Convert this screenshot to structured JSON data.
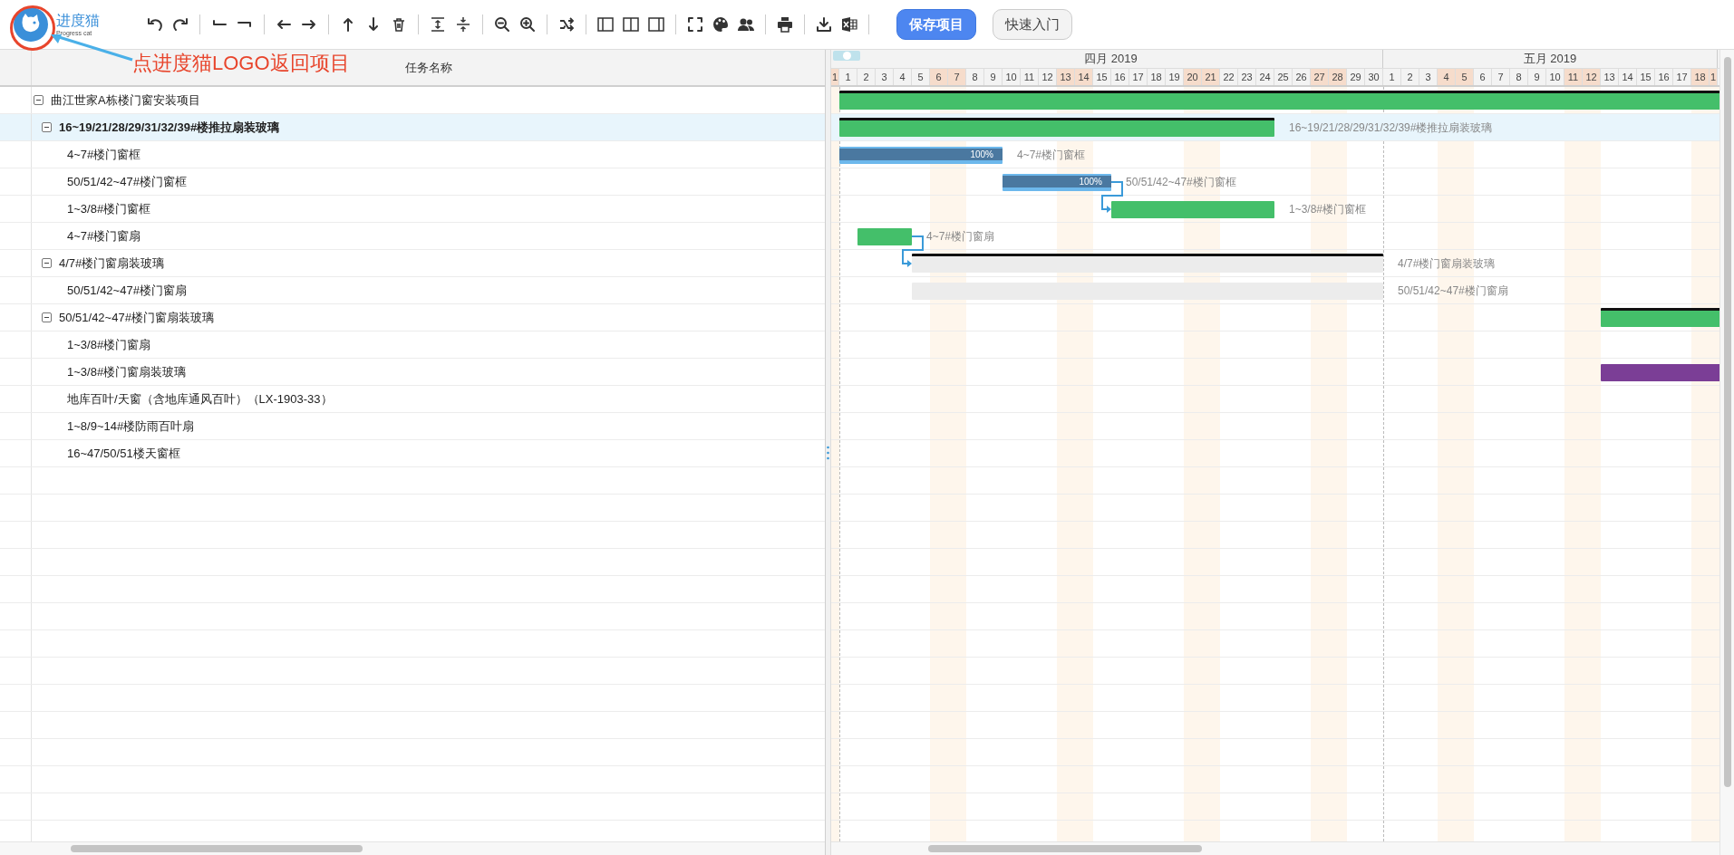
{
  "toolbar": {
    "logo": {
      "name": "进度猫",
      "subtitle": "Progress cat"
    },
    "buttons": [
      {
        "label": "保存项目",
        "kind": "primary"
      },
      {
        "label": "快速入门",
        "kind": "secondary"
      }
    ]
  },
  "annotation": {
    "text": "点进度猫LOGO返回项目"
  },
  "grid": {
    "columns": [
      {
        "label": "任务名称"
      }
    ]
  },
  "timeline": {
    "zoom_slider": {
      "level": 0.5
    },
    "leading_day": {
      "label": "1",
      "weekend": true
    },
    "months": [
      {
        "label": "四月 2019",
        "days": [
          {
            "label": "1",
            "weekend": false
          },
          {
            "label": "2",
            "weekend": false
          },
          {
            "label": "3",
            "weekend": false
          },
          {
            "label": "4",
            "weekend": false
          },
          {
            "label": "5",
            "weekend": false
          },
          {
            "label": "6",
            "weekend": true
          },
          {
            "label": "7",
            "weekend": true
          },
          {
            "label": "8",
            "weekend": false
          },
          {
            "label": "9",
            "weekend": false
          },
          {
            "label": "10",
            "weekend": false
          },
          {
            "label": "11",
            "weekend": false
          },
          {
            "label": "12",
            "weekend": false
          },
          {
            "label": "13",
            "weekend": true
          },
          {
            "label": "14",
            "weekend": true
          },
          {
            "label": "15",
            "weekend": false
          },
          {
            "label": "16",
            "weekend": false
          },
          {
            "label": "17",
            "weekend": false
          },
          {
            "label": "18",
            "weekend": false
          },
          {
            "label": "19",
            "weekend": false
          },
          {
            "label": "20",
            "weekend": true
          },
          {
            "label": "21",
            "weekend": true
          },
          {
            "label": "22",
            "weekend": false
          },
          {
            "label": "23",
            "weekend": false
          },
          {
            "label": "24",
            "weekend": false
          },
          {
            "label": "25",
            "weekend": false
          },
          {
            "label": "26",
            "weekend": false
          },
          {
            "label": "27",
            "weekend": true
          },
          {
            "label": "28",
            "weekend": true
          },
          {
            "label": "29",
            "weekend": false
          },
          {
            "label": "30",
            "weekend": false
          }
        ]
      },
      {
        "label": "五月 2019",
        "days": [
          {
            "label": "1",
            "weekend": false
          },
          {
            "label": "2",
            "weekend": false
          },
          {
            "label": "3",
            "weekend": false
          },
          {
            "label": "4",
            "weekend": true
          },
          {
            "label": "5",
            "weekend": true
          },
          {
            "label": "6",
            "weekend": false
          },
          {
            "label": "7",
            "weekend": false
          },
          {
            "label": "8",
            "weekend": false
          },
          {
            "label": "9",
            "weekend": false
          },
          {
            "label": "10",
            "weekend": false
          },
          {
            "label": "11",
            "weekend": true
          },
          {
            "label": "12",
            "weekend": true
          },
          {
            "label": "13",
            "weekend": false
          },
          {
            "label": "14",
            "weekend": false
          },
          {
            "label": "15",
            "weekend": false
          },
          {
            "label": "16",
            "weekend": false
          },
          {
            "label": "17",
            "weekend": false
          },
          {
            "label": "18",
            "weekend": true
          }
        ]
      }
    ],
    "trailing_day": {
      "label": "1",
      "weekend": true
    }
  },
  "tasks": [
    {
      "name": "曲江世家A栋楼门窗安装项目",
      "expanded": true,
      "selected": false,
      "linked_to_next": false,
      "bar": {
        "kind": "summary",
        "color": "#44bf6a"
      },
      "children": [
        {
          "name": "16~19/21/28/29/31/32/39#楼推拉扇装玻璃",
          "expanded": true,
          "selected": true,
          "linked_to_next": false,
          "bar": {
            "kind": "summary",
            "color": "#44bf6a",
            "label": "16~19/21/28/29/31/32/39#楼推拉扇装玻璃"
          },
          "children": [
            {
              "name": "4~7#楼门窗框",
              "selected": false,
              "linked_to_next": false,
              "bar": {
                "kind": "progress",
                "color": "#6db8ec",
                "level": 1,
                "progress_text": "100%",
                "label": "4~7#楼门窗框"
              }
            },
            {
              "name": "50/51/42~47#楼门窗框",
              "selected": false,
              "linked_to_next": true,
              "bar": {
                "kind": "progress",
                "color": "#6db8ec",
                "level": 1,
                "progress_text": "100%",
                "label": "50/51/42~47#楼门窗框"
              }
            },
            {
              "name": "1~3/8#楼门窗框",
              "selected": false,
              "linked_to_next": false,
              "bar": {
                "kind": "task",
                "color": "#44bf6a",
                "label": "1~3/8#楼门窗框"
              }
            },
            {
              "name": "4~7#楼门窗扇",
              "selected": false,
              "linked_to_next": true,
              "bar": {
                "kind": "task",
                "color": "#44bf6a",
                "label": "4~7#楼门窗扇"
              }
            }
          ]
        },
        {
          "name": "4/7#楼门窗扇装玻璃",
          "expanded": true,
          "selected": false,
          "linked_to_next": false,
          "bar": {
            "kind": "summary",
            "color": "#ececec",
            "label": "4/7#楼门窗扇装玻璃"
          },
          "children": [
            {
              "name": "50/51/42~47#楼门窗扇",
              "selected": false,
              "linked_to_next": false,
              "bar": {
                "kind": "task",
                "color": "#ececec",
                "label": "50/51/42~47#楼门窗扇"
              }
            }
          ]
        },
        {
          "name": "50/51/42~47#楼门窗扇装玻璃",
          "expanded": true,
          "selected": false,
          "linked_to_next": false,
          "bar": {
            "kind": "summary",
            "color": "#44bf6a"
          },
          "children": [
            {
              "name": "1~3/8#楼门窗扇",
              "selected": false,
              "linked_to_next": false
            },
            {
              "name": "1~3/8#楼门窗扇装玻璃",
              "selected": false,
              "linked_to_next": false,
              "bar": {
                "kind": "task",
                "color": "#7b3e96"
              }
            },
            {
              "name": "地库百叶/天窗（含地库通风百叶）（LX-1903-33）",
              "selected": false,
              "linked_to_next": false
            },
            {
              "name": "1~8/9~14#楼防雨百叶扇",
              "selected": false,
              "linked_to_next": false
            },
            {
              "name": "16~47/50/51楼天窗框",
              "selected": false,
              "linked_to_next": false
            }
          ]
        }
      ]
    }
  ]
}
